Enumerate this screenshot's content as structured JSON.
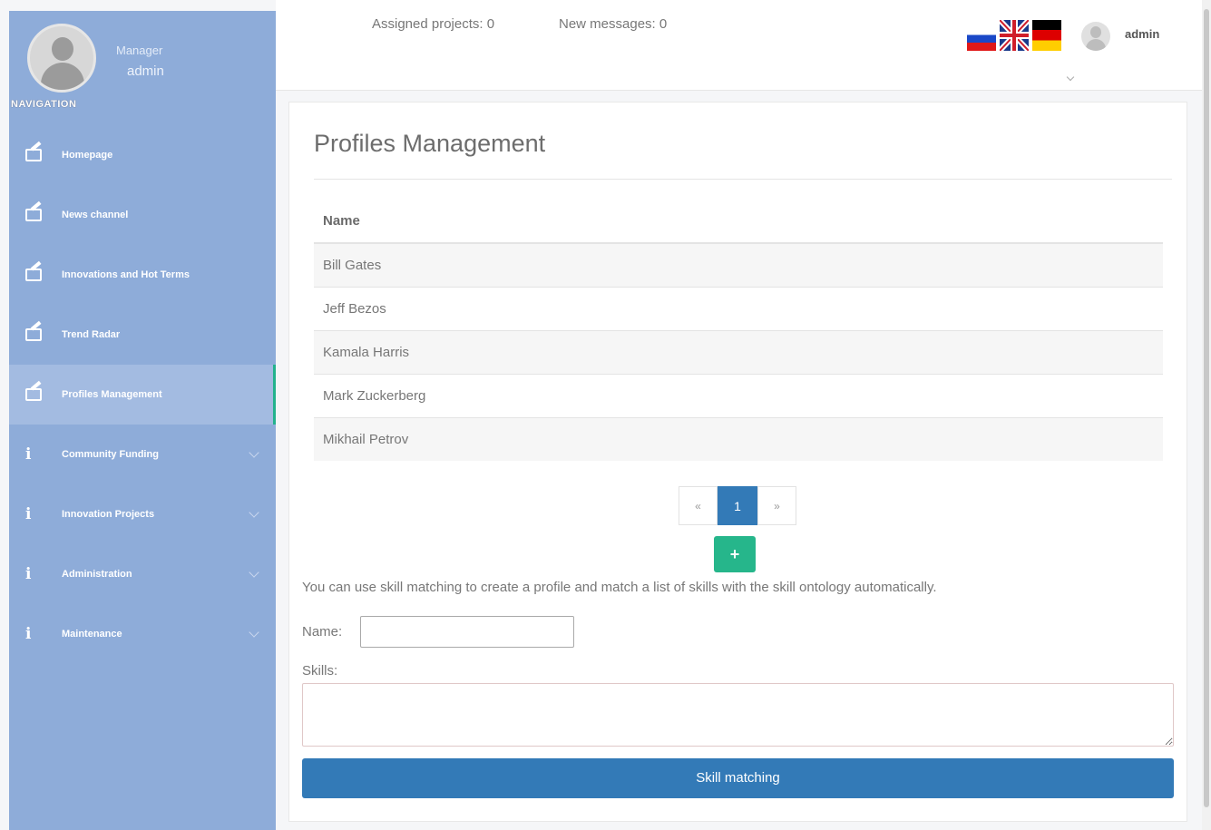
{
  "sidebar": {
    "profile": {
      "role": "Manager",
      "username": "admin"
    },
    "navigation_heading": "NAVIGATION",
    "items": [
      {
        "label": "Homepage",
        "icon": "edit-icon"
      },
      {
        "label": "News channel",
        "icon": "edit-icon"
      },
      {
        "label": "Innovations and Hot Terms",
        "icon": "edit-icon"
      },
      {
        "label": "Trend Radar",
        "icon": "edit-icon"
      },
      {
        "label": "Profiles Management",
        "icon": "edit-icon",
        "active": true
      },
      {
        "label": "Community Funding",
        "icon": "info-icon",
        "expandable": true
      },
      {
        "label": "Innovation Projects",
        "icon": "info-icon",
        "expandable": true
      },
      {
        "label": "Administration",
        "icon": "info-icon",
        "expandable": true
      },
      {
        "label": "Maintenance",
        "icon": "info-icon",
        "expandable": true
      }
    ],
    "colors": {
      "background": "#8eacd9",
      "active_accent": "#22b28d"
    }
  },
  "topbar": {
    "assigned_projects": "Assigned projects: 0",
    "new_messages": "New messages: 0",
    "languages": [
      "russian-flag-icon",
      "uk-flag-icon",
      "german-flag-icon"
    ],
    "user": "admin"
  },
  "main": {
    "title": "Profiles Management",
    "table": {
      "header": "Name",
      "rows": [
        "Bill Gates",
        "Jeff Bezos",
        "Kamala Harris",
        "Mark Zuckerberg",
        "Mikhail Petrov"
      ]
    },
    "pagination": {
      "prev": "«",
      "current": "1",
      "next": "»"
    },
    "add_button": "+",
    "hint": "You can use skill matching to create a profile and match a list of skills with the skill ontology automatically.",
    "name_label": "Name:",
    "name_value": "",
    "skills_label": "Skills:",
    "skills_value": "",
    "submit_label": "Skill matching",
    "colors": {
      "primary": "#337ab7",
      "success": "#26b68b"
    }
  }
}
